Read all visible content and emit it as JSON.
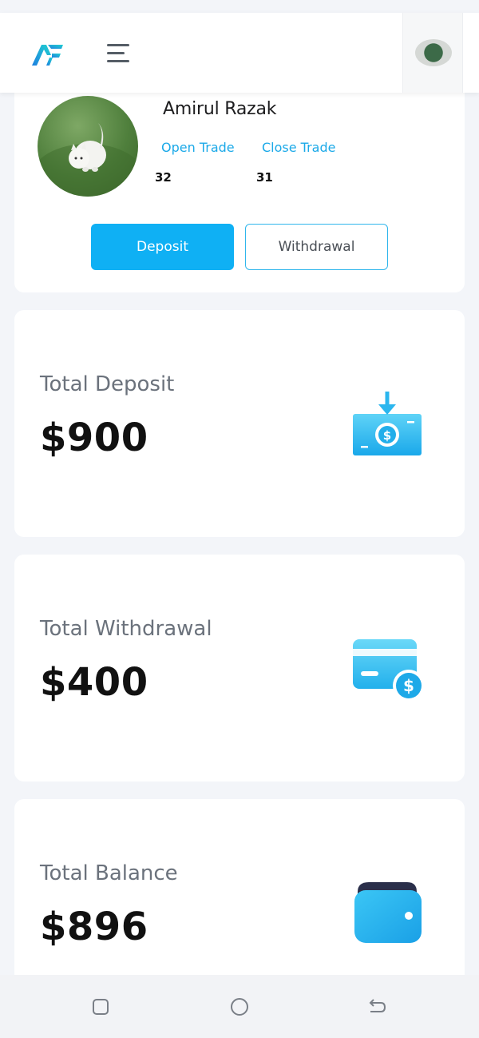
{
  "header": {
    "logo_icon": "af-logo-icon",
    "menu_icon": "hamburger-menu-icon",
    "avatar_icon": "user-avatar-icon"
  },
  "profile": {
    "name": "Amirul Razak",
    "open_trade_label": "Open Trade",
    "close_trade_label": "Close Trade",
    "open_trade_count": "32",
    "close_trade_count": "31",
    "deposit_button": "Deposit",
    "withdrawal_button": "Withdrawal",
    "photo_icon": "profile-photo-cat"
  },
  "stats": [
    {
      "label": "Total Deposit",
      "value": "$900",
      "icon": "money-deposit-icon"
    },
    {
      "label": "Total Withdrawal",
      "value": "$400",
      "icon": "card-withdrawal-icon"
    },
    {
      "label": "Total Balance",
      "value": "$896",
      "icon": "wallet-icon"
    }
  ],
  "navbar": {
    "recent_icon": "recent-apps-icon",
    "home_icon": "home-circle-icon",
    "back_icon": "back-arrow-icon"
  },
  "colors": {
    "accent": "#0fb0f4",
    "link": "#1ba9e8",
    "background": "#f3f5f9"
  }
}
